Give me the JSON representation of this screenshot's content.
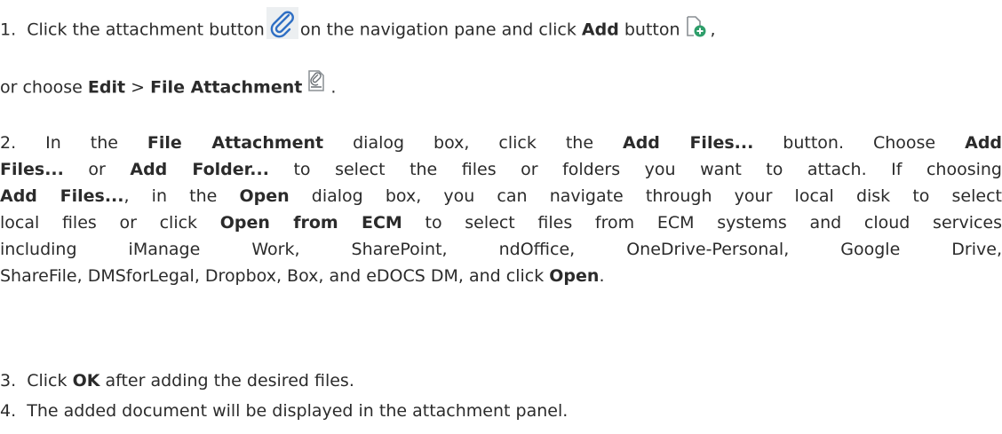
{
  "step1": {
    "num": "1.",
    "t1": "Click the attachment button",
    "t2": "on the navigation pane and click",
    "add": "Add",
    "t3": "button",
    "comma": ",",
    "t4": "or choose",
    "edit": "Edit",
    "gt": ">",
    "file_attachment": "File Attachment",
    "period": ".",
    "icons": [
      "paperclip-icon",
      "add-file-icon",
      "file-attachment-icon"
    ]
  },
  "step2": {
    "num": "2.",
    "a1": "In the",
    "b1": "File Attachment",
    "a2": "dialog box, click the",
    "b2": "Add Files...",
    "a3": "button. Choose",
    "b3": "Add",
    "b4": "Files...",
    "a4": "or",
    "b5": "Add Folder...",
    "a5": "to select the files or folders you want to attach. If choosing",
    "b6": "Add Files...",
    "a6": ", in the",
    "b7": "Open",
    "a7": "dialog box, you can navigate through your local disk to select",
    "a8": "local files or click",
    "b8": "Open from ECM",
    "a9": "to select files from ECM systems and cloud services",
    "a10": "including iManage Work, SharePoint, ndOffice, OneDrive-Personal, Google Drive,",
    "a11": "ShareFile, DMSforLegal, Dropbox, Box, and eDOCS DM, and click",
    "b9": "Open",
    "a12": "."
  },
  "step3": {
    "num": "3.",
    "a": "Click",
    "b": "OK",
    "c": "after adding the desired files."
  },
  "step4": {
    "num": "4.",
    "a": "The added document will be displayed in the attachment panel."
  }
}
